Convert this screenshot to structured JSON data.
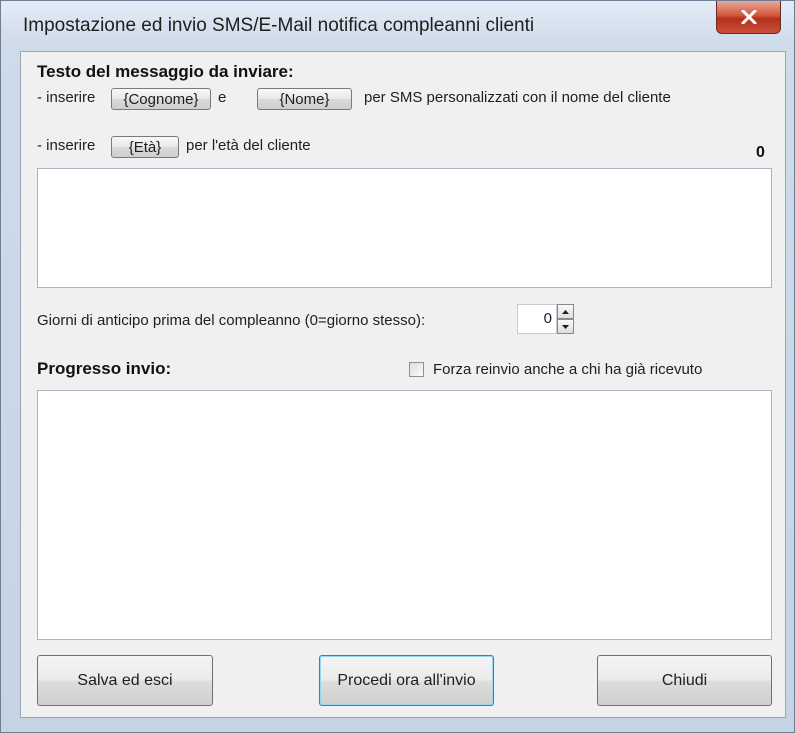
{
  "window": {
    "title": "Impostazione ed invio SMS/E-Mail notifica compleanni clienti",
    "close_label": "✕"
  },
  "message": {
    "header": "Testo del messaggio da inviare:",
    "line1_prefix": "- inserire",
    "token_surname": "{Cognome}",
    "line1_and": "e",
    "token_name": "{Nome}",
    "line1_suffix": "per SMS personalizzati con il nome del cliente",
    "line2_prefix": "- inserire",
    "token_age": "{Età}",
    "line2_suffix": "per l'età del cliente",
    "char_count": "0",
    "text_value": ""
  },
  "advance": {
    "label": "Giorni di anticipo prima del compleanno (0=giorno stesso):",
    "value": "0"
  },
  "progress": {
    "header": "Progresso invio:",
    "force_resend_label": "Forza reinvio anche a chi ha già ricevuto",
    "force_resend_checked": false,
    "log_value": ""
  },
  "buttons": {
    "save": "Salva ed esci",
    "send": "Procedi ora all'invio",
    "close": "Chiudi"
  },
  "colors": {
    "close_button": "#c9503a",
    "dialog_background": "#f0f0f0",
    "frame": "#c5d3e3"
  },
  "icons": {
    "close": "close-icon",
    "spin_up": "arrow-up-icon",
    "spin_down": "arrow-down-icon"
  }
}
